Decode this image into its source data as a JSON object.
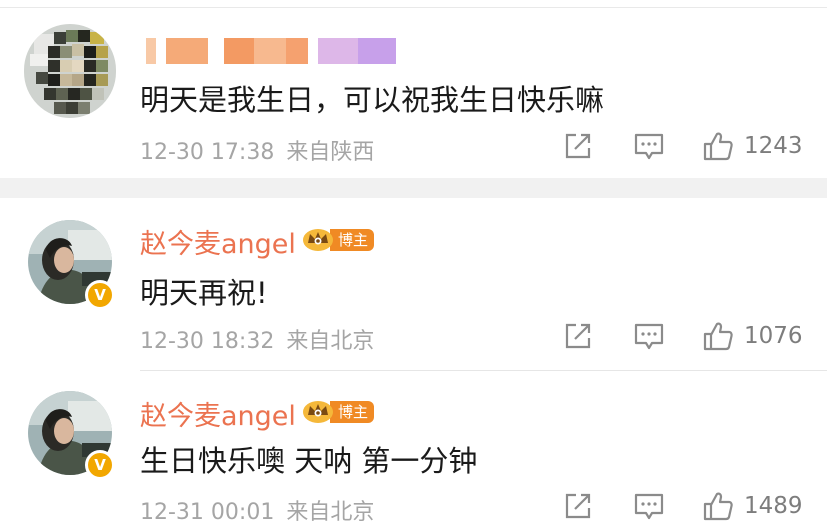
{
  "comments": [
    {
      "user": "",
      "text": "明天是我生日，可以祝我生日快乐嘛",
      "time": "12-30 17:38",
      "source": "来自陕西",
      "likes": "1243"
    },
    {
      "user": "赵今麦angel",
      "badge": "博主",
      "text": "明天再祝!",
      "time": "12-30 18:32",
      "source": "来自北京",
      "likes": "1076"
    },
    {
      "user": "赵今麦angel",
      "badge": "博主",
      "text": "生日快乐噢 天呐 第一分钟",
      "time": "12-31 00:01",
      "source": "来自北京",
      "likes": "1489"
    }
  ],
  "icons": {
    "share": "share-icon",
    "reply": "comment-icon",
    "like": "thumbs-up-icon",
    "verified": "verified-v-icon",
    "badge": "crown-icon"
  },
  "colors": {
    "username": "#eb7350",
    "badge": "#f08a24",
    "verified": "#f2a700",
    "meta": "#a5a5a5"
  }
}
